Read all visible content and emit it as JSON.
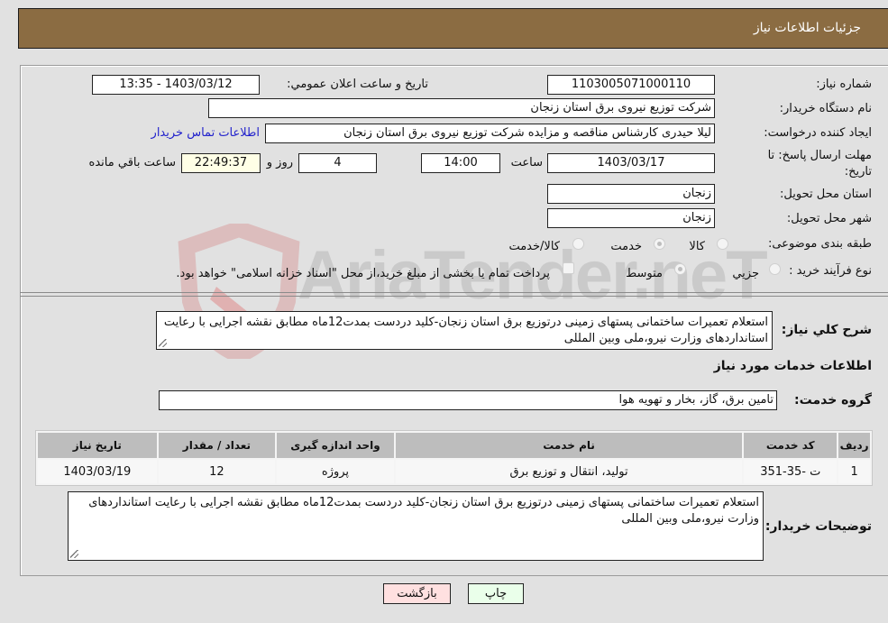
{
  "header": {
    "title": "جزئيات اطلاعات نياز"
  },
  "form": {
    "need_number": {
      "label": "شماره نياز:",
      "value": "1103005071000110"
    },
    "announce_datetime": {
      "label": "تاريخ و ساعت اعلان عمومي:",
      "value": "1403/03/12 - 13:35"
    },
    "buyer_org": {
      "label": "نام دستگاه خريدار:",
      "value": "شرکت توزيع نيروی برق استان زنجان"
    },
    "creator": {
      "label": "ايجاد کننده درخواست:",
      "value": "ليلا حيدری کارشناس مناقصه و مزايده شرکت توزيع نيروی برق استان زنجان",
      "contact_link": "اطلاعات تماس خريدار"
    },
    "deadline": {
      "label_line1": "مهلت ارسال پاسخ: تا",
      "label_line2": "تاريخ:",
      "date": "1403/03/17",
      "time_label": "ساعت",
      "time": "14:00",
      "days": "4",
      "days_label": "روز و",
      "remaining": "22:49:37",
      "remaining_label": "ساعت باقي مانده"
    },
    "province": {
      "label": "استان محل تحويل:",
      "value": "زنجان"
    },
    "city": {
      "label": "شهر محل تحويل:",
      "value": "زنجان"
    },
    "category": {
      "label": "طبقه بندی موضوعی:",
      "options": [
        "کالا",
        "خدمت",
        "کالا/خدمت"
      ],
      "selected": "خدمت"
    },
    "purchase_type": {
      "label": "نوع فرآيند خريد :",
      "options": [
        "جزيي",
        "متوسط"
      ],
      "selected": "متوسط",
      "treasury_checkbox_label": "پرداخت تمام يا بخشی از مبلغ خريد،از محل \"اسناد خزانه اسلامی\" خواهد بود.",
      "treasury_checked": false
    },
    "description": {
      "label": "شرح کلي نياز:",
      "value": "استعلام تعميرات ساختمانی پستهای زمينی درتوزيع برق استان زنجان-کليد دردست بمدت12ماه مطابق نقشه اجرايی با رعايت استانداردهای وزارت نيرو،ملی وبين المللی"
    }
  },
  "services": {
    "section_title": "اطلاعات خدمات مورد نياز",
    "group_label": "گروه خدمت:",
    "group_value": "تامين برق، گاز، بخار و تهويه هوا",
    "table": {
      "headers": [
        "رديف",
        "کد خدمت",
        "نام خدمت",
        "واحد اندازه گيری",
        "تعداد / مقدار",
        "تاريخ نياز"
      ],
      "rows": [
        [
          "1",
          "ت -35-351",
          "توليد، انتقال و توزيع برق",
          "پروژه",
          "12",
          "1403/03/19"
        ]
      ]
    }
  },
  "buyer_notes": {
    "label": "توضيحات خريدار:",
    "value": "استعلام تعميرات ساختمانی پستهای زمينی درتوزيع برق استان زنجان-کليد دردست بمدت12ماه مطابق نقشه اجرايی با رعايت استانداردهای وزارت نيرو،ملی وبين المللی"
  },
  "buttons": {
    "print": "چاپ",
    "back": "بازگشت"
  },
  "watermark": {
    "text": "AriaTender.neT"
  },
  "colors": {
    "header_bg": "#8b6c42",
    "link": "#2222cc",
    "back_btn_bg": "#ffe0e0",
    "print_btn_bg": "#eaffea",
    "remaining_bg": "#ffffe6"
  }
}
